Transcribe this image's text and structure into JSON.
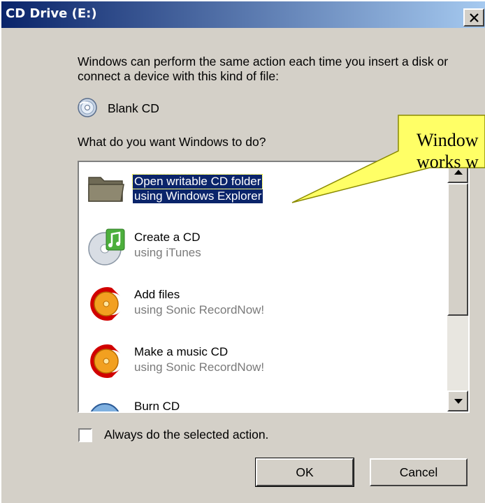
{
  "window": {
    "title": "CD Drive (E:)",
    "close_glyph": "✕"
  },
  "intro_text": "Windows can perform the same action each time you insert a disk or connect a device with this kind of file:",
  "device": {
    "icon": "blank-cd-icon",
    "label": "Blank CD"
  },
  "question": "What do you want Windows to do?",
  "actions": [
    {
      "primary": "Open writable CD folder",
      "secondary": "using Windows Explorer",
      "icon": "folder-icon",
      "selected": true
    },
    {
      "primary": "Create a CD",
      "secondary": "using iTunes",
      "icon": "itunes-icon",
      "selected": false
    },
    {
      "primary": "Add files",
      "secondary": "using Sonic RecordNow!",
      "icon": "sonic-recordnow-icon",
      "selected": false
    },
    {
      "primary": "Make a music CD",
      "secondary": "using Sonic RecordNow!",
      "icon": "sonic-recordnow-icon",
      "selected": false
    },
    {
      "primary": "Burn CD",
      "secondary": "",
      "icon": "burn-cd-icon",
      "selected": false
    }
  ],
  "always_checkbox": {
    "label": "Always do the selected action.",
    "checked": false
  },
  "buttons": {
    "ok": "OK",
    "cancel": "Cancel"
  },
  "callout": {
    "line1": "Window",
    "line2": "works w",
    "fill_color": "#ffff66"
  },
  "colors": {
    "dialog_face": "#d4d0c8",
    "titlebar_start": "#0a246a",
    "titlebar_end": "#a6caf0",
    "selection": "#0a246a"
  }
}
